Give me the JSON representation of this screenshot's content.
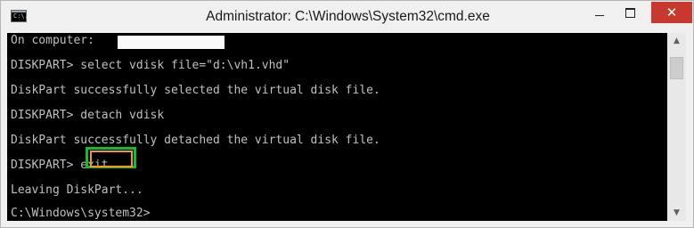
{
  "window": {
    "title": "Administrator: C:\\Windows\\System32\\cmd.exe",
    "icon_text": "C:\\.",
    "controls": {
      "minimize": "minimize",
      "maximize": "maximize",
      "close": "✕"
    }
  },
  "console": {
    "lines": [
      "On computer:",
      "DISKPART> select vdisk file=\"d:\\vh1.vhd\"",
      "DiskPart successfully selected the virtual disk file.",
      "DISKPART> detach vdisk",
      "DiskPart successfully detached the virtual disk file.",
      "DISKPART> exit",
      "Leaving DiskPart...",
      "C:\\Windows\\system32>"
    ]
  },
  "highlight": {
    "target_text": "exit",
    "outer_color": "#17b92e",
    "inner_color": "#f39c12"
  },
  "scrollbar": {
    "up_icon": "▲",
    "down_icon": "▼"
  }
}
